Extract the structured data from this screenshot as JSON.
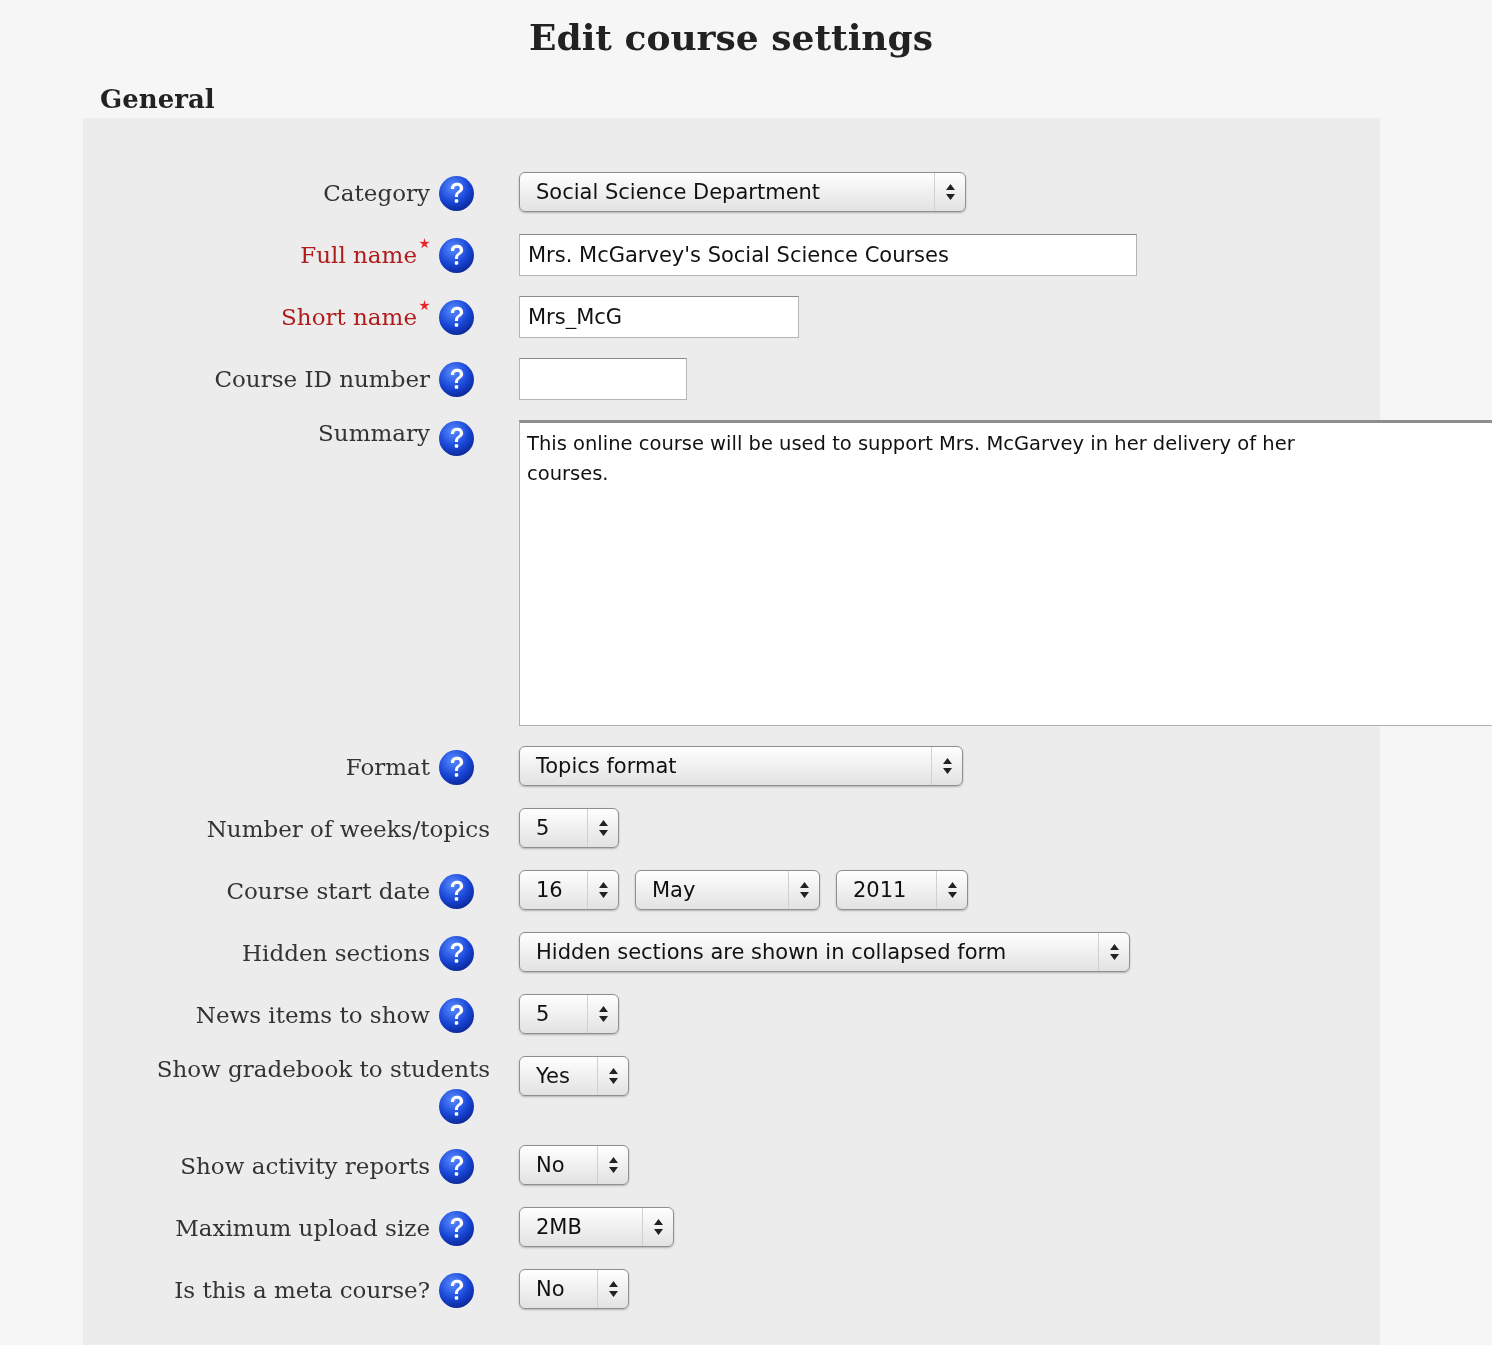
{
  "title": "Edit course settings",
  "section": {
    "legend": "General",
    "fields": [
      {
        "label": "Category",
        "required": false,
        "help": true,
        "kind": "select",
        "controls": [
          {
            "value": "Social Science Department"
          }
        ]
      },
      {
        "label": "Full name",
        "required": true,
        "help": true,
        "kind": "text",
        "controls": [
          {
            "value": "Mrs. McGarvey's Social Science Courses"
          }
        ]
      },
      {
        "label": "Short name",
        "required": true,
        "help": true,
        "kind": "text",
        "controls": [
          {
            "value": "Mrs_McG"
          }
        ]
      },
      {
        "label": "Course ID number",
        "required": false,
        "help": true,
        "kind": "text"
      },
      {
        "label": "Summary",
        "required": false,
        "help": true,
        "kind": "textarea",
        "lines": [
          "This online course will be used to support Mrs. McGarvey in her delivery of her",
          "courses."
        ]
      },
      {
        "label": "Format",
        "required": false,
        "help": true,
        "kind": "select",
        "controls": [
          {
            "value": "Topics format"
          }
        ]
      },
      {
        "label": "Number of weeks/topics",
        "required": false,
        "help": false,
        "kind": "select",
        "controls": [
          {
            "value": "5"
          }
        ]
      },
      {
        "label": "Course start date",
        "required": false,
        "help": true,
        "kind": "select",
        "controls": [
          {
            "value": "16"
          },
          {
            "value": "May"
          },
          {
            "value": "2011"
          }
        ]
      },
      {
        "label": "Hidden sections",
        "required": false,
        "help": true,
        "kind": "select",
        "controls": [
          {
            "value": "Hidden sections are shown in collapsed form"
          }
        ]
      },
      {
        "label": "News items to show",
        "required": false,
        "help": true,
        "kind": "select",
        "controls": [
          {
            "value": "5"
          }
        ]
      },
      {
        "label": "Show gradebook to students",
        "required": false,
        "help": true,
        "kind": "select",
        "controls": [
          {
            "value": "Yes"
          }
        ]
      },
      {
        "label": "Show activity reports",
        "required": false,
        "help": true,
        "kind": "select",
        "controls": [
          {
            "value": "No"
          }
        ]
      },
      {
        "label": "Maximum upload size",
        "required": false,
        "help": true,
        "kind": "select",
        "controls": [
          {
            "value": "2MB"
          }
        ]
      },
      {
        "label": "Is this a meta course?",
        "required": false,
        "help": true,
        "kind": "select",
        "controls": [
          {
            "value": "No"
          }
        ]
      }
    ]
  }
}
